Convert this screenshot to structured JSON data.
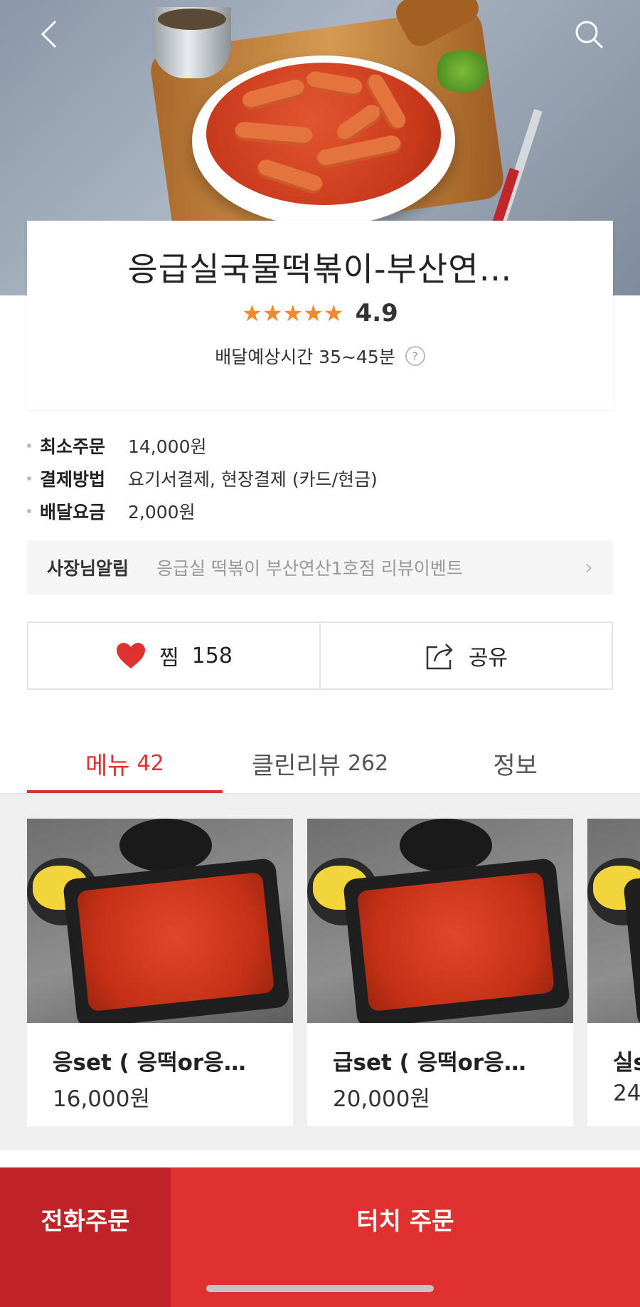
{
  "header": {
    "back_icon": "chevron-left-icon",
    "search_icon": "search-icon"
  },
  "store": {
    "name": "응급실국물떡볶이-부산연…",
    "stars": "★★★★★",
    "rating": "4.9",
    "eta": "배달예상시간 35~45분",
    "help": "?"
  },
  "details": [
    {
      "label": "최소주문",
      "value": "14,000원"
    },
    {
      "label": "결제방법",
      "value": "요기서결제, 현장결제 (카드/현금)"
    },
    {
      "label": "배달요금",
      "value": "2,000원"
    }
  ],
  "notice": {
    "label": "사장님알림",
    "text": "응급실 떡볶이 부산연산1호점 리뷰이벤트",
    "chevron": "›"
  },
  "actions": {
    "like_label": "찜",
    "like_count": "158",
    "like_icon": "heart-icon",
    "share_label": "공유",
    "share_icon": "share-icon"
  },
  "tabs": [
    {
      "label": "메뉴",
      "count": "42",
      "active": true
    },
    {
      "label": "클린리뷰",
      "count": "262",
      "active": false
    },
    {
      "label": "정보",
      "count": "",
      "active": false
    }
  ],
  "menu_items": [
    {
      "name": "응set ( 응떡or응…",
      "price": "16,000원"
    },
    {
      "name": "급set ( 응떡or응…",
      "price": "20,000원"
    },
    {
      "name": "실s",
      "price": "24"
    }
  ],
  "bottom": {
    "phone_order": "전화주문",
    "touch_order": "터치 주문"
  },
  "colors": {
    "accent": "#e03131",
    "phone_button": "#bf2328",
    "star": "#f08a2c"
  }
}
